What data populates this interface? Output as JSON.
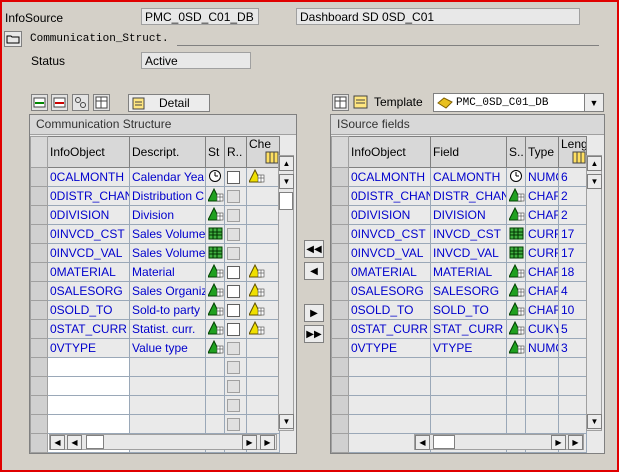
{
  "header": {
    "infosource_label": "InfoSource",
    "infosource_value": "PMC_0SD_C01_DB",
    "infosource_desc": "Dashboard SD 0SD_C01",
    "comm_label": "Communication_Struct.",
    "status_label": "Status",
    "status_value": "Active"
  },
  "left_panel": {
    "detail_label": "Detail",
    "title": "Communication Structure",
    "columns": [
      "InfoObject",
      "Descript.",
      "St",
      "R..",
      "Che"
    ],
    "rows": [
      {
        "infoobject": "0CALMONTH",
        "descr": "Calendar Yea",
        "st": "clock",
        "r": "checkbox",
        "che": "warn"
      },
      {
        "infoobject": "0DISTR_CHAN",
        "descr": "Distribution C",
        "st": "tri",
        "r": "disabled",
        "che": ""
      },
      {
        "infoobject": "0DIVISION",
        "descr": "Division",
        "st": "tri",
        "r": "disabled",
        "che": ""
      },
      {
        "infoobject": "0INVCD_CST",
        "descr": "Sales Volume",
        "st": "grid",
        "r": "disabled",
        "che": ""
      },
      {
        "infoobject": "0INVCD_VAL",
        "descr": "Sales Volume",
        "st": "grid",
        "r": "disabled",
        "che": ""
      },
      {
        "infoobject": "0MATERIAL",
        "descr": "Material",
        "st": "tri",
        "r": "checkbox",
        "che": "warn"
      },
      {
        "infoobject": "0SALESORG",
        "descr": "Sales Organiz",
        "st": "tri",
        "r": "checkbox",
        "che": "warn"
      },
      {
        "infoobject": "0SOLD_TO",
        "descr": "Sold-to party",
        "st": "tri",
        "r": "checkbox",
        "che": "warn"
      },
      {
        "infoobject": "0STAT_CURR",
        "descr": "Statist. curr.",
        "st": "tri",
        "r": "checkbox",
        "che": "warn"
      },
      {
        "infoobject": "0VTYPE",
        "descr": "Value type",
        "st": "tri",
        "r": "disabled",
        "che": ""
      }
    ],
    "empty_rows": 5
  },
  "right_panel": {
    "template_label": "Template",
    "template_value": "PMC_0SD_C01_DB",
    "title": "ISource fields",
    "columns": [
      "InfoObject",
      "Field",
      "S..",
      "Type",
      "Leng"
    ],
    "rows": [
      {
        "infoobject": "0CALMONTH",
        "field": "CALMONTH",
        "s": "clock",
        "type": "NUMC",
        "len": "6"
      },
      {
        "infoobject": "0DISTR_CHAN",
        "field": "DISTR_CHAN",
        "s": "tri",
        "type": "CHAR",
        "len": "2"
      },
      {
        "infoobject": "0DIVISION",
        "field": "DIVISION",
        "s": "tri",
        "type": "CHAR",
        "len": "2"
      },
      {
        "infoobject": "0INVCD_CST",
        "field": "INVCD_CST",
        "s": "grid",
        "type": "CURR",
        "len": "17"
      },
      {
        "infoobject": "0INVCD_VAL",
        "field": "INVCD_VAL",
        "s": "grid",
        "type": "CURR",
        "len": "17"
      },
      {
        "infoobject": "0MATERIAL",
        "field": "MATERIAL",
        "s": "tri",
        "type": "CHAR",
        "len": "18"
      },
      {
        "infoobject": "0SALESORG",
        "field": "SALESORG",
        "s": "tri",
        "type": "CHAR",
        "len": "4"
      },
      {
        "infoobject": "0SOLD_TO",
        "field": "SOLD_TO",
        "s": "tri",
        "type": "CHAR",
        "len": "10"
      },
      {
        "infoobject": "0STAT_CURR",
        "field": "STAT_CURR",
        "s": "tri",
        "type": "CUKY",
        "len": "5"
      },
      {
        "infoobject": "0VTYPE",
        "field": "VTYPE",
        "s": "tri",
        "type": "NUMC",
        "len": "3"
      }
    ],
    "empty_rows": 5
  },
  "icons": {
    "clock": "clock-icon",
    "tri": "characteristic-icon",
    "grid": "keyfigure-icon",
    "warn": "warning-icon"
  }
}
